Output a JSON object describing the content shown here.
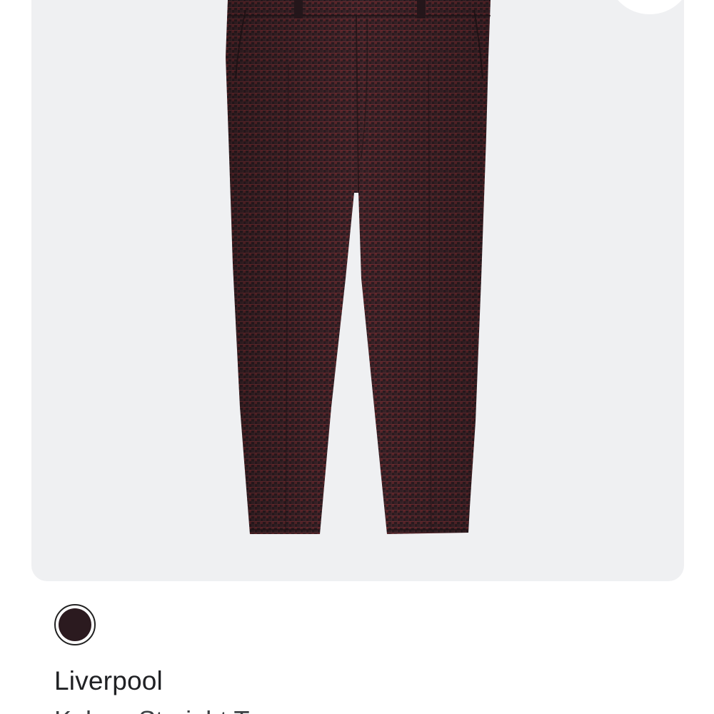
{
  "product": {
    "brand": "Liverpool",
    "name": "Kelsey Straight Trouser",
    "image_icon": "pants-photo",
    "favorite_icon": "heart-icon"
  },
  "swatches": [
    {
      "color": "#2b1a1f",
      "selected": true
    }
  ],
  "colors": {
    "card_background": "#eff0f2",
    "fabric_base": "#2c1c21",
    "fabric_check": "#6e2d33",
    "text_primary": "#202124"
  }
}
